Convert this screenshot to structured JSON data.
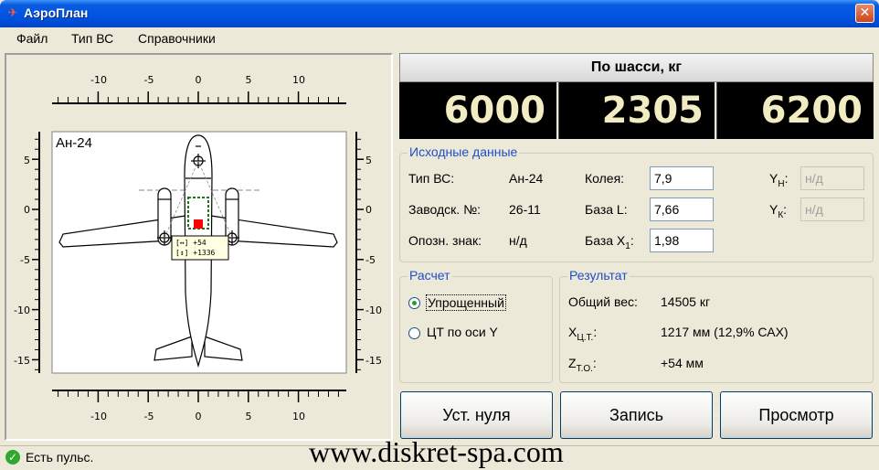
{
  "window": {
    "title": "АэроПлан",
    "close_glyph": "✕"
  },
  "menu": [
    {
      "label": "Файл"
    },
    {
      "label": "Тип ВС"
    },
    {
      "label": "Справочники"
    }
  ],
  "gauge": {
    "aircraft_label": "Ан-24",
    "x_ticks": [
      "-10",
      "-5",
      "0",
      "5",
      "10"
    ],
    "y_ticks": [
      "5",
      "0",
      "-5",
      "-10",
      "-15"
    ],
    "cg_tooltip": {
      "line1": "[↔] +54",
      "line2": "[↕] +1336"
    }
  },
  "weights": {
    "header": "По шасси, кг",
    "values": [
      "6000",
      "2305",
      "6200"
    ]
  },
  "source_data": {
    "title": "Исходные данные",
    "type_label": "Тип ВС:",
    "type_value": "Ан-24",
    "serial_label": "Заводск. №:",
    "serial_value": "26-11",
    "reg_label": "Опозн. знак:",
    "reg_value": "н/д",
    "track_label": "Колея:",
    "track_value": "7,9",
    "base_l_label": "База L:",
    "base_l_value": "7,66",
    "base_x1_label_main": "База X",
    "base_x1_label_sub": "1",
    "base_x1_label_end": ":",
    "base_x1_value": "1,98",
    "yh_label_main": "Y",
    "yh_label_sub": "Н",
    "yh_label_end": ":",
    "yh_value": "н/д",
    "yk_label_main": "Y",
    "yk_label_sub": "К",
    "yk_label_end": ":",
    "yk_value": "н/д"
  },
  "calc": {
    "title": "Расчет",
    "option1": "Упрощенный",
    "option2": "ЦТ по оси Y",
    "selected": "option1"
  },
  "result": {
    "title": "Результат",
    "total_label": "Общий вес:",
    "total_value": "14505 кг",
    "xct_label_main": "X",
    "xct_label_sub": "Ц.Т.",
    "xct_label_end": ":",
    "xct_value": "1217 мм (12,9% САХ)",
    "zto_label_main": "Z",
    "zto_label_sub": "Т.О.",
    "zto_label_end": ":",
    "zto_value": "+54 мм"
  },
  "buttons": {
    "zero": "Уст. нуля",
    "record": "Запись",
    "view": "Просмотр"
  },
  "status": {
    "text": "Есть пульс.",
    "icon_glyph": "✓"
  },
  "watermark": "www.diskret-spa.com",
  "colors": {
    "accent": "#1f4ec8",
    "display_bg": "#000000",
    "display_fg": "#f2ecc2",
    "cg_marker": "#ff0000",
    "cg_box": "#1a7a1a"
  }
}
